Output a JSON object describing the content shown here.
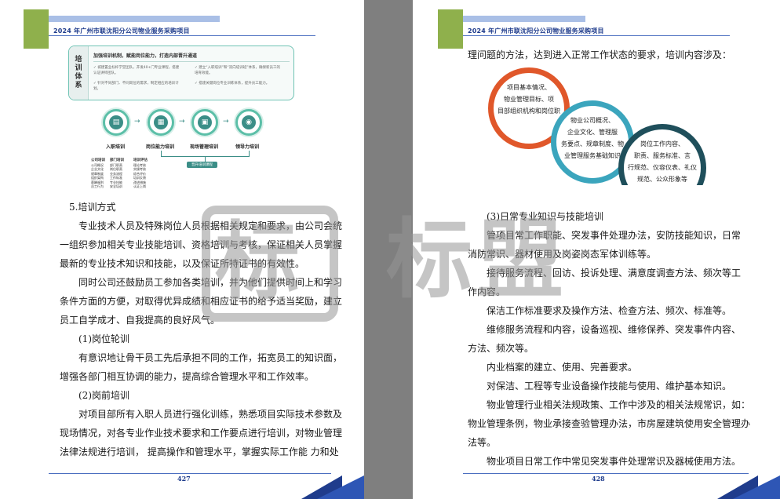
{
  "header": {
    "title": "2024 年广州市联沈阳分公司物业服务采购项目"
  },
  "left_page": {
    "page_number": "427",
    "diagram": {
      "side_label": "培训体系",
      "title": "加强培训机制，赋能岗位能力，打造内部晋升通道",
      "items": [
        "城建置业标杆学堂团队，开发40+门专业课程，搭建认证讲师团队。",
        "建立“入职培训”和“双向培训班”体系，确保新员工的培育效能。",
        "针对不同部门、不同岗位的需求，制定相应的培训计划。",
        "搭建关键岗位专业训练体系，提升员工能力。"
      ],
      "steps": [
        "入职培训",
        "岗位能力培训",
        "现场管理培训",
        "领导力培训"
      ],
      "pill": "晋升培训课程",
      "table": {
        "col1_head": "公司培训",
        "col1": [
          "公司概况",
          "企业文化",
          "规章制度",
          "组织架构",
          "薪酬福利",
          "员工行为"
        ],
        "col2_head": "部门培训",
        "col2": [
          "部门职责",
          "岗位职责",
          "业务流程",
          "工作标准",
          "专业技能",
          "安全培训"
        ],
        "col3_head": "培训评估",
        "col3": [
          "理论考核",
          "实操考核",
          "综合评价",
          "培训反馈",
          "改进措施",
          "认证上岗"
        ]
      }
    },
    "paragraphs": [
      "5.培训方式",
      "专业技术人员及特殊岗位人员根据相关规定和要求，由公司会统",
      "一组织参加相关专业技能培训、资格培训与考核，保证相关人员掌握",
      "最新的专业技术知识和技能，以及保证所持证书的有效性。",
      "同时公司还鼓励员工参加各类培训，并为他们提供时间上和学习",
      "条件方面的方便，对取得优异成绩和相应证书的给予适当奖励，建立",
      "员工自学成才、自我提高的良好风气。",
      "(1)岗位轮训",
      "有意识地让骨干员工先后承担不同的工作，拓宽员工的知识面，",
      "增强各部门相互协调的能力，提高综合管理水平和工作效率。",
      "(2)岗前培训",
      "对项目部所有入职人员进行强化训练，熟悉项目实际技术参数及",
      "现场情况，对各专业作业技术要求和工作要点进行培训，对物业管理",
      "法律法规进行培训， 提高操作和管理水平，掌握实际工作能 力和处"
    ]
  },
  "right_page": {
    "page_number": "428",
    "intro": "理问题的方法，达到进入正常工作状态的要求，培训内容涉及：",
    "rings": [
      [
        "项目基本情况、",
        "物业管理目标、项",
        "目部组织机构和岗位职"
      ],
      [
        "物业公司概况、",
        "企业文化、管理服",
        "务要点、规章制度、物",
        "业管理服务基础知识"
      ],
      [
        "岗位工作内容、",
        "职责、服务标准、言",
        "行规范、仪容仪表、礼仪",
        "规范、公众形象等"
      ]
    ],
    "ring_colors": [
      "#e0572a",
      "#3ba5bd",
      "#1f4f5b"
    ],
    "paragraphs": [
      "(3)日常专业知识与技能培训",
      "管项目常工作职能、突发事件处理办法，安防技能知识，日常",
      "消防常识、器材使用及岗姿岗态军体训练等。",
      "接待服务流程、回访、投诉处理、满意度调查方法、频次等工",
      "作内容。",
      "保洁工作标准要求及操作方法、检查方法、频次、标准等。",
      "维修服务流程和内容，设备巡视、维修保养、突发事件内容、",
      "方法、频次等。",
      "内业档案的建立、使用、完善要求。",
      "对保洁、工程等专业设备操作技能与使用、维护基本知识。",
      "物业管理行业相关法规政策、工作中涉及的相关法规常识，如：",
      "物业管理条例，物业承接查验管理办法，市房屋建筑使用安全管理办",
      "法等。",
      "物业项目日常工作中常见突发事件处理常识及器械使用方法。"
    ]
  },
  "watermark": {
    "icon_char": "标",
    "text": "标盟"
  },
  "colors": {
    "accent_green": "#8fb04c",
    "header_blue": "#1f3c8c",
    "teal": "#3b8e87"
  }
}
